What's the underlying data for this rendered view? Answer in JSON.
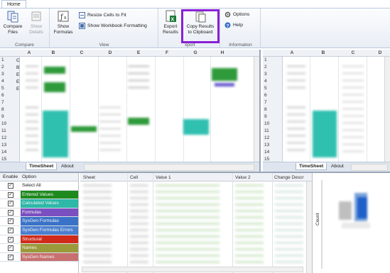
{
  "ribbon": {
    "tab_home": "Home",
    "compare_files": "Compare\nFiles",
    "show_details": "Show\nDetails",
    "group_compare": "Compare",
    "show_formulas": "Show\nFormulas",
    "resize_cells": "Resize Cells to Fit",
    "show_workbook_formatting": "Show Workbook Formatting",
    "group_view": "View",
    "export_results": "Export\nResults",
    "copy_results": "Copy Results\nto Clipboard",
    "group_export": "xport",
    "options": "Options",
    "help": "Help",
    "group_information": "Information"
  },
  "left_sheet": {
    "columns": [
      "A",
      "B",
      "C",
      "D",
      "E",
      "F",
      "G",
      "H"
    ],
    "rows": [
      "1",
      "2",
      "3",
      "4",
      "5",
      "6",
      "7",
      "8",
      "9",
      "10",
      "11",
      "12",
      "13",
      "14",
      "15"
    ],
    "row_prefixes": [
      "C",
      "B",
      "E",
      "E",
      "E",
      "",
      "",
      "",
      "",
      "",
      "",
      "",
      "",
      "",
      ""
    ],
    "tabs": [
      "TimeSheet",
      "About"
    ]
  },
  "right_sheet": {
    "columns": [
      "A",
      "B",
      "C",
      "D"
    ],
    "rows": [
      "1",
      "2",
      "3",
      "4",
      "5",
      "6",
      "7",
      "8",
      "9",
      "10",
      "11",
      "12",
      "13",
      "14",
      "15"
    ],
    "tabs": [
      "TimeSheet",
      "About"
    ]
  },
  "options_panel": {
    "header_enable": "Enable",
    "header_option": "Option",
    "items": [
      {
        "label": "Select All",
        "color": "#ffffff"
      },
      {
        "label": "Entered Values",
        "color": "#1e8a1e"
      },
      {
        "label": "Calculated Values",
        "color": "#2eb8a8"
      },
      {
        "label": "Formulas",
        "color": "#7a4fc0"
      },
      {
        "label": "SysGen Formulas",
        "color": "#3a72c8"
      },
      {
        "label": "SysGen Formulas Errors",
        "color": "#4a7fd0"
      },
      {
        "label": "Structural",
        "color": "#d02a1a"
      },
      {
        "label": "Names",
        "color": "#9a9a3a"
      },
      {
        "label": "SysGen Names",
        "color": "#c87070"
      }
    ]
  },
  "results_grid": {
    "headers": [
      "Sheet",
      "Cell",
      "Value 1",
      "Value 2",
      "Change Descr"
    ]
  },
  "chart": {
    "ylabel": "Count"
  }
}
